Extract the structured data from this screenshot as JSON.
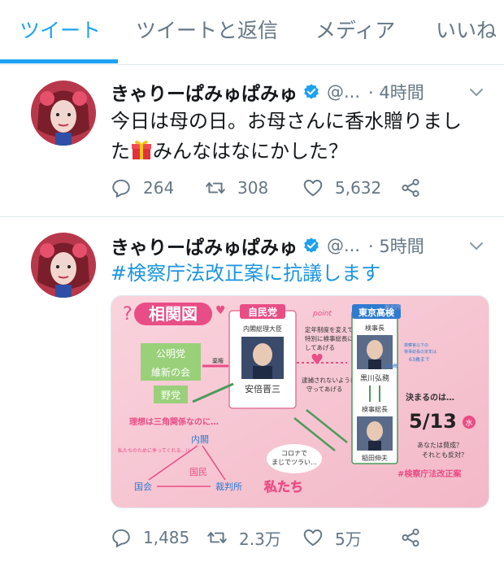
{
  "tabs": [
    {
      "label": "ツイート",
      "active": true
    },
    {
      "label": "ツイートと返信",
      "active": false
    },
    {
      "label": "メディア",
      "active": false
    },
    {
      "label": "いいね",
      "active": false
    }
  ],
  "colors": {
    "accent": "#1da1f2",
    "link": "#1b95e0",
    "muted": "#657786",
    "card_bg": "#f7c9d6"
  },
  "tweets": [
    {
      "name": "きゃりーぱみゅぱみゅ",
      "handle": "@...",
      "time": "· 4時間",
      "text_line1": "今日は母の日。お母さんに香水贈りまし",
      "text_line2_a": "た",
      "text_line2_b": "みんなはなにかした？",
      "replies": "264",
      "retweets": "308",
      "likes": "5,632"
    },
    {
      "name": "きゃりーぱみゅぱみゅ",
      "handle": "@...",
      "time": "· 5時間",
      "text": "#検察庁法改正案に抗議します",
      "replies": "1,485",
      "retweets": "2.3万",
      "likes": "5万"
    }
  ],
  "image": {
    "title": "相関図",
    "ldp": "自民党",
    "pm_role": "内閣総理大臣",
    "pm_name": "安倍晋三",
    "ldp_text_1": "定年制度を変えて",
    "ldp_text_2": "特別に検事総長に",
    "ldp_text_3": "してあげる",
    "point": "point",
    "komeito": "公明党",
    "ishin": "維新の会",
    "yato": "野党",
    "abstain": "棄権",
    "tokyo": "東京高検",
    "kenjicho": "検事長",
    "kurokawa": "黒川弘務",
    "age63": "63歳",
    "age_note_1": "検察官以下の",
    "age_note_2": "検事総長の定年は",
    "age_note_3": "63歳まで",
    "kenji_socho": "検事総長",
    "inada": "稲田伸夫",
    "kimaru": "決まるのは…",
    "date": "5/13",
    "weekday": "水",
    "sansei": "あなたは賛成？",
    "hantai": "それとも反対？",
    "hashtag": "#検察庁法改正案",
    "riso": "理想は三角関係なのに…",
    "naikaku": "内閣",
    "kokkai": "国会",
    "saibansho": "裁判所",
    "kokumin": "国民",
    "watashitachi": "私たち",
    "corona_1": "コロナで",
    "corona_2": "まじでツラい…",
    "taiho": "逮捕されないように",
    "mamotte": "守ってあげる",
    "left_note": "私たちのために争ってくれる…!!",
    "saibansho_watermark": "裁判所"
  }
}
